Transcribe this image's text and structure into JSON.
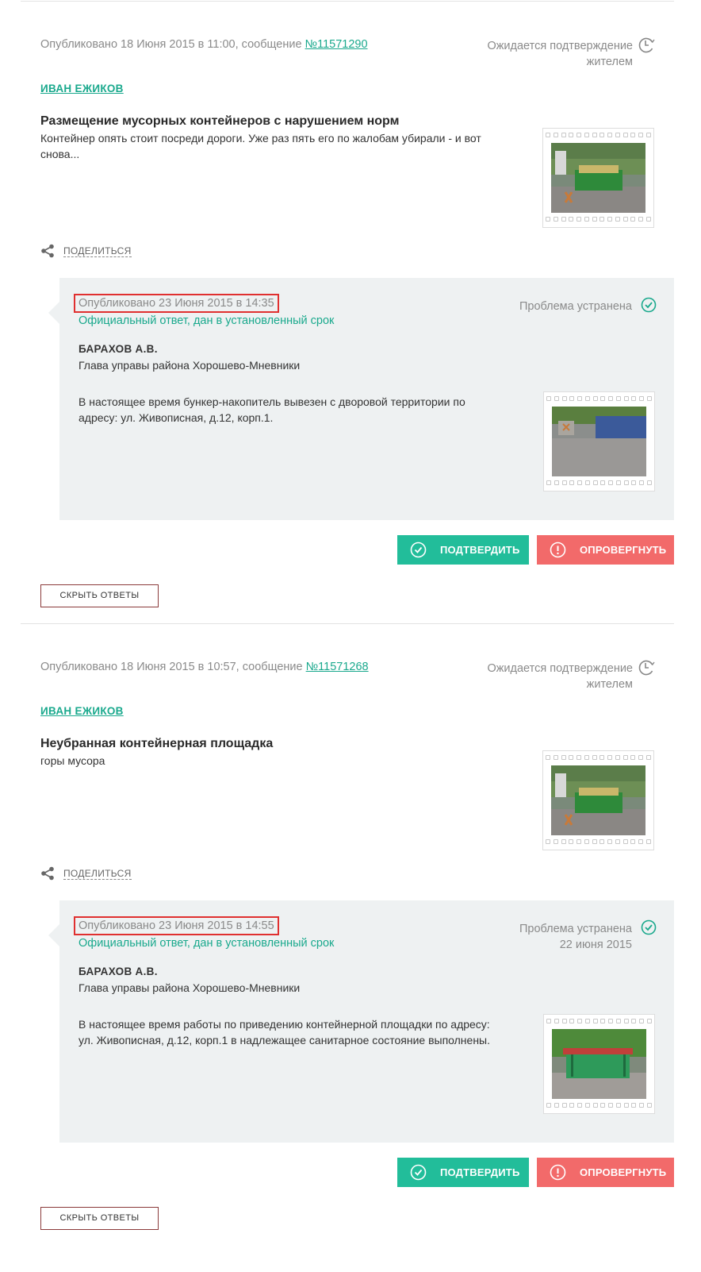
{
  "posts": [
    {
      "published_prefix": "Опубликовано 18 Июня 2015 в 11:00, сообщение ",
      "message_link": "№11571290",
      "status": "Ожидается подтверждение жителем",
      "author": "ИВАН ЕЖИКОВ",
      "title": "Размещение мусорных контейнеров с нарушением норм",
      "description": "Контейнер опять стоит посреди дороги. Уже раз пять его по жалобам убирали - и вот снова...",
      "share_label": "ПОДЕЛИТЬСЯ",
      "answer": {
        "published": "Опубликовано 23 Июня 2015 в 14:35",
        "official_note": "Официальный ответ, дан в установленный срок",
        "status": "Проблема устранена",
        "status_date": "",
        "official_name": "БАРАХОВ А.В.",
        "official_role": "Глава управы района Хорошево-Мневники",
        "text": "В настоящее время бункер-накопитель вывезен с дворовой территории по адресу: ул. Живописная, д.12, корп.1."
      },
      "confirm_label": "ПОДТВЕРДИТЬ",
      "reject_label": "ОПРОВЕРГНУТЬ",
      "hide_label": "СКРЫТЬ ОТВЕТЫ"
    },
    {
      "published_prefix": "Опубликовано 18 Июня 2015 в 10:57, сообщение ",
      "message_link": "№11571268",
      "status": "Ожидается подтверждение жителем",
      "author": "ИВАН ЕЖИКОВ",
      "title": "Неубранная контейнерная площадка",
      "description": "горы мусора",
      "share_label": "ПОДЕЛИТЬСЯ",
      "answer": {
        "published": "Опубликовано 23 Июня 2015 в 14:55",
        "official_note": "Официальный ответ, дан в установленный срок",
        "status": "Проблема устранена",
        "status_date": "22 июня 2015",
        "official_name": "БАРАХОВ А.В.",
        "official_role": "Глава управы района Хорошево-Мневники",
        "text": "В настоящее время работы по приведению контейнерной площадки по адресу: ул. Живописная, д.12, корп.1 в надлежащее санитарное состояние выполнены."
      },
      "confirm_label": "ПОДТВЕРДИТЬ",
      "reject_label": "ОПРОВЕРГНУТЬ",
      "hide_label": "СКРЫТЬ ОТВЕТЫ"
    }
  ],
  "icons": {
    "clock": "clock-icon",
    "check": "check-circle-icon",
    "share": "share-icon",
    "confirm": "check-circle-icon",
    "reject": "exclamation-circle-icon"
  },
  "colors": {
    "accent": "#1aa98d",
    "confirm": "#22bd9a",
    "reject": "#f26a6a",
    "answer_bg": "#eef1f2",
    "highlight_border": "#e03030"
  }
}
